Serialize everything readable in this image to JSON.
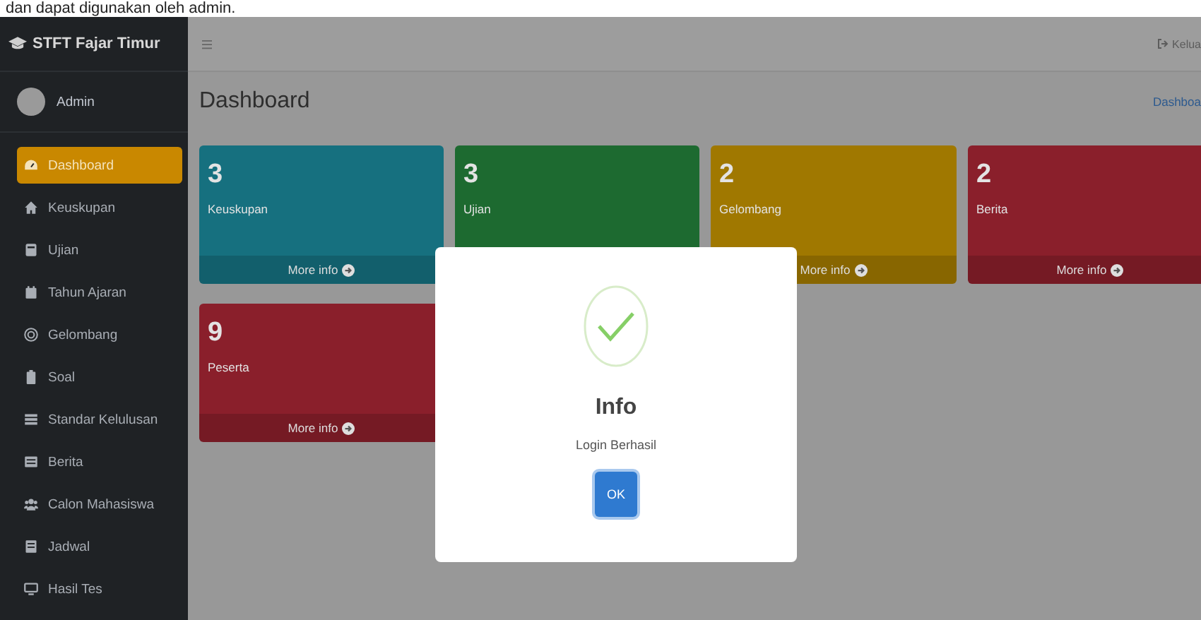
{
  "document_text": "dan dapat digunakan oleh admin.",
  "sidebar": {
    "brand": "STFT Fajar Timur",
    "user": "Admin",
    "items": [
      {
        "label": "Dashboard",
        "selected": true
      },
      {
        "label": "Keuskupan",
        "selected": false
      },
      {
        "label": "Ujian",
        "selected": false
      },
      {
        "label": "Tahun Ajaran",
        "selected": false
      },
      {
        "label": "Gelombang",
        "selected": false
      },
      {
        "label": "Soal",
        "selected": false
      },
      {
        "label": "Standar Kelulusan",
        "selected": false
      },
      {
        "label": "Berita",
        "selected": false
      },
      {
        "label": "Calon Mahasiswa",
        "selected": false
      },
      {
        "label": "Jadwal",
        "selected": false
      },
      {
        "label": "Hasil Tes",
        "selected": false
      }
    ]
  },
  "header": {
    "logout": "Kelua"
  },
  "page": {
    "title": "Dashboard",
    "breadcrumb": "Dashboa"
  },
  "cards": [
    {
      "value": "3",
      "label": "Keuskupan",
      "color": "#16707f",
      "more_info": "More info"
    },
    {
      "value": "3",
      "label": "Ujian",
      "color": "#1d6a30"
    },
    {
      "value": "2",
      "label": "Gelombang",
      "color": "#a07800",
      "more_info": "More info"
    },
    {
      "value": "2",
      "label": "Berita",
      "color": "#8a1f2b",
      "more_info": "More info"
    },
    {
      "value": "9",
      "label": "Peserta",
      "color": "#8a1f2b",
      "more_info": "More info"
    }
  ],
  "modal": {
    "title": "Info",
    "message": "Login Berhasil",
    "button": "OK"
  }
}
